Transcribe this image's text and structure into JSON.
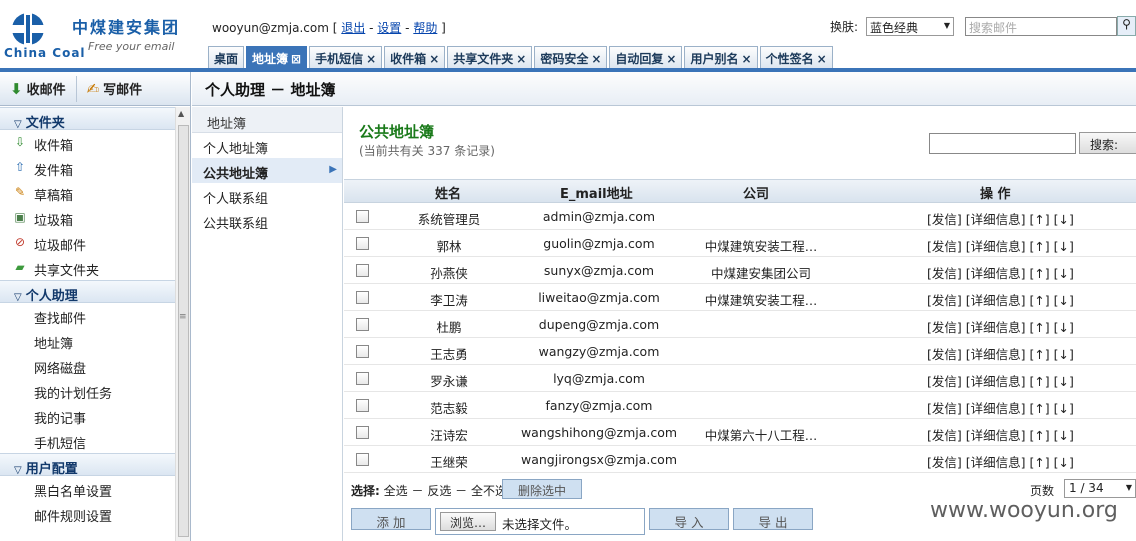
{
  "brand": {
    "name_cn": "中煤建安集团",
    "name_en": "China Coal",
    "slogan": "Free your email"
  },
  "header": {
    "user_email": "wooyun@zmja.com",
    "bracket_open": "[",
    "logout": "退出",
    "sep": "-",
    "settings": "设置",
    "help": "帮助",
    "bracket_close": "]",
    "skin_label": "换肤:",
    "skin_value": "蓝色经典",
    "search_placeholder": "搜索邮件"
  },
  "tabs": [
    {
      "label": "桌面",
      "closable": false,
      "active": false
    },
    {
      "label": "地址簿",
      "closable": true,
      "active": true
    },
    {
      "label": "手机短信",
      "closable": true,
      "active": false
    },
    {
      "label": "收件箱",
      "closable": true,
      "active": false
    },
    {
      "label": "共享文件夹",
      "closable": true,
      "active": false
    },
    {
      "label": "密码安全",
      "closable": true,
      "active": false
    },
    {
      "label": "自动回复",
      "closable": true,
      "active": false
    },
    {
      "label": "用户别名",
      "closable": true,
      "active": false
    },
    {
      "label": "个性签名",
      "closable": true,
      "active": false
    }
  ],
  "sidebar": {
    "receive": "收邮件",
    "compose": "写邮件",
    "folders_title": "文件夹",
    "folders": [
      {
        "label": "收件箱",
        "icon": "inbox-icon",
        "glyph": "⇩",
        "color": "#2f8a2f"
      },
      {
        "label": "发件箱",
        "icon": "outbox-icon",
        "glyph": "⇧",
        "color": "#2b6cb0"
      },
      {
        "label": "草稿箱",
        "icon": "drafts-icon",
        "glyph": "✎",
        "color": "#c77800"
      },
      {
        "label": "垃圾箱",
        "icon": "trash-icon",
        "glyph": "▣",
        "color": "#4a7f4a"
      },
      {
        "label": "垃圾邮件",
        "icon": "spam-icon",
        "glyph": "⊘",
        "color": "#c0392b"
      },
      {
        "label": "共享文件夹",
        "icon": "shared-folder-icon",
        "glyph": "▰",
        "color": "#3d9a3d"
      }
    ],
    "assistant_title": "个人助理",
    "assistant": [
      "查找邮件",
      "地址簿",
      "网络磁盘",
      "我的计划任务",
      "我的记事",
      "手机短信"
    ],
    "config_title": "用户配置",
    "config": [
      "黑白名单设置",
      "邮件规则设置"
    ]
  },
  "main": {
    "breadcrumb": "个人助理 － 地址簿",
    "nav_title": "地址簿",
    "nav": [
      {
        "label": "个人地址簿",
        "active": false
      },
      {
        "label": "公共地址簿",
        "active": true
      },
      {
        "label": "个人联系组",
        "active": false
      },
      {
        "label": "公共联系组",
        "active": false
      }
    ],
    "book_title": "公共地址簿",
    "book_count": "(当前共有关 337 条记录)",
    "search_button": "搜索:",
    "columns": {
      "name": "姓名",
      "email": "E_mail地址",
      "company": "公司",
      "actions": "操 作"
    },
    "action_text": "[发信] [详细信息] [↑] [↓]",
    "rows": [
      {
        "name": "系统管理员",
        "email": "admin@zmja.com",
        "company": ""
      },
      {
        "name": "郭林",
        "email": "guolin@zmja.com",
        "company": "中煤建筑安装工程…"
      },
      {
        "name": "孙燕侠",
        "email": "sunyx@zmja.com",
        "company": "中煤建安集团公司"
      },
      {
        "name": "李卫涛",
        "email": "liweitao@zmja.com",
        "company": "中煤建筑安装工程…"
      },
      {
        "name": "杜鹏",
        "email": "dupeng@zmja.com",
        "company": ""
      },
      {
        "name": "王志勇",
        "email": "wangzy@zmja.com",
        "company": ""
      },
      {
        "name": "罗永谦",
        "email": "lyq@zmja.com",
        "company": ""
      },
      {
        "name": "范志毅",
        "email": "fanzy@zmja.com",
        "company": ""
      },
      {
        "name": "汪诗宏",
        "email": "wangshihong@zmja.com",
        "company": "中煤第六十八工程…"
      },
      {
        "name": "王继荣",
        "email": "wangjirongsx@zmja.com",
        "company": ""
      }
    ],
    "select_label": "选择:",
    "select_all": "全选",
    "select_invert": "反选",
    "select_none": "全不选",
    "delete_selected": "删除选中",
    "page_label": "页数",
    "page_value": "1 / 34",
    "add_button": "添 加",
    "browse_button": "浏览…",
    "file_status": "未选择文件。",
    "import_button": "导 入",
    "export_button": "导 出"
  },
  "watermark": "www.wooyun.org"
}
